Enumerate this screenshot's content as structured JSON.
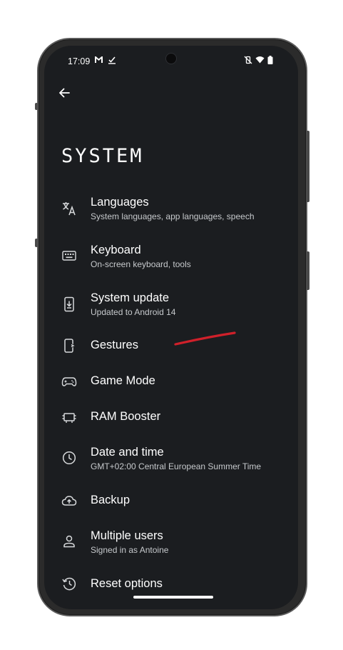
{
  "status_bar": {
    "time": "17:09",
    "left_icons": [
      "gmail-icon",
      "task-check-icon"
    ],
    "right_icons": [
      "vibrate-off-icon",
      "wifi-icon",
      "battery-icon"
    ]
  },
  "header": {
    "back_icon": "arrow-left-icon",
    "title": "SYSTEM"
  },
  "settings_items": [
    {
      "icon": "translate-icon",
      "label": "Languages",
      "subtitle": "System languages, app languages, speech"
    },
    {
      "icon": "keyboard-icon",
      "label": "Keyboard",
      "subtitle": "On-screen keyboard, tools"
    },
    {
      "icon": "system-update-icon",
      "label": "System update",
      "subtitle": "Updated to Android 14"
    },
    {
      "icon": "gestures-icon",
      "label": "Gestures",
      "subtitle": ""
    },
    {
      "icon": "gamepad-icon",
      "label": "Game Mode",
      "subtitle": ""
    },
    {
      "icon": "ram-icon",
      "label": "RAM Booster",
      "subtitle": ""
    },
    {
      "icon": "clock-icon",
      "label": "Date and time",
      "subtitle": "GMT+02:00 Central European Summer Time"
    },
    {
      "icon": "cloud-upload-icon",
      "label": "Backup",
      "subtitle": ""
    },
    {
      "icon": "person-icon",
      "label": "Multiple users",
      "subtitle": "Signed in as Antoine"
    },
    {
      "icon": "restore-icon",
      "label": "Reset options",
      "subtitle": ""
    }
  ],
  "colors": {
    "background": "#1b1d20",
    "text_primary": "#ffffff",
    "text_secondary": "#c6c9cc",
    "annotation_mark": "#d0202a"
  }
}
